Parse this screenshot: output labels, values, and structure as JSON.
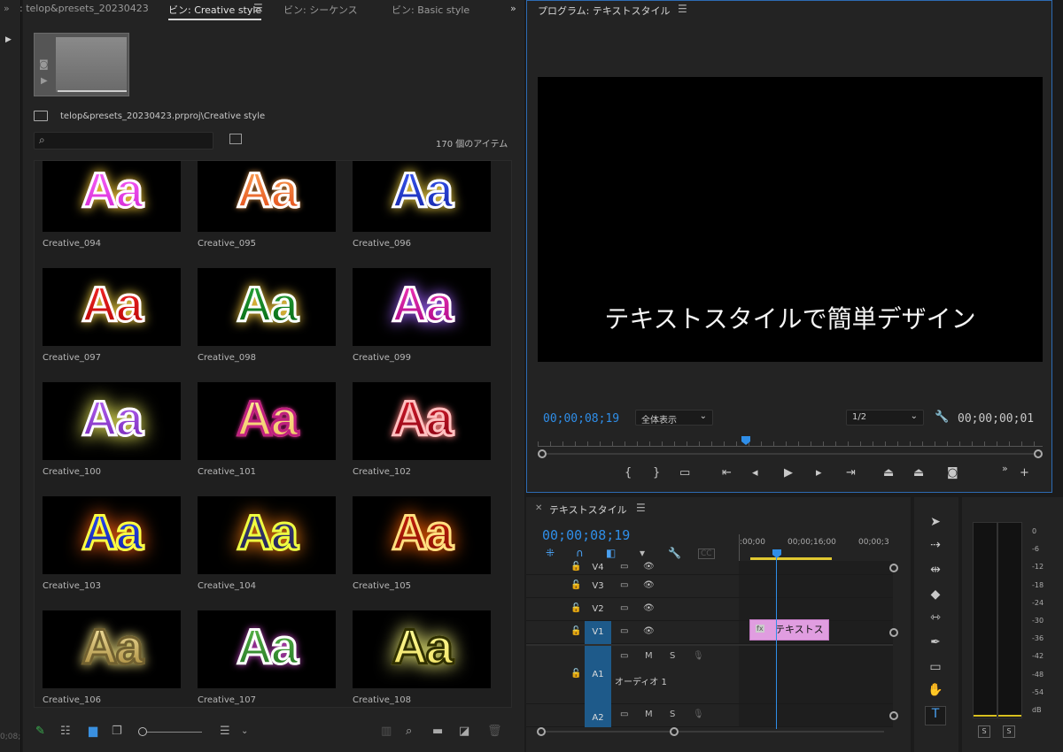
{
  "project": {
    "tabs": [
      {
        "label": ": telop&presets_20230423"
      },
      {
        "label": "ビン: Creative style"
      },
      {
        "label": "ビン: シーケンス"
      },
      {
        "label": "ビン: Basic style"
      }
    ],
    "path": "telop&presets_20230423.prproj\\Creative style",
    "search_placeholder": "",
    "item_count": "170 個のアイテム",
    "items": [
      {
        "name": "Creative_094",
        "preview": "Aa"
      },
      {
        "name": "Creative_095",
        "preview": "Aa"
      },
      {
        "name": "Creative_096",
        "preview": "Aa"
      },
      {
        "name": "Creative_097",
        "preview": "Aa"
      },
      {
        "name": "Creative_098",
        "preview": "Aa"
      },
      {
        "name": "Creative_099",
        "preview": "Aa"
      },
      {
        "name": "Creative_100",
        "preview": "Aa"
      },
      {
        "name": "Creative_101",
        "preview": "Aa"
      },
      {
        "name": "Creative_102",
        "preview": "Aa"
      },
      {
        "name": "Creative_103",
        "preview": "Aa"
      },
      {
        "name": "Creative_104",
        "preview": "Aa"
      },
      {
        "name": "Creative_105",
        "preview": "Aa"
      },
      {
        "name": "Creative_106",
        "preview": "Aa"
      },
      {
        "name": "Creative_107",
        "preview": "Aa"
      },
      {
        "name": "Creative_108",
        "preview": "Aa"
      }
    ]
  },
  "program": {
    "title": "プログラム: テキストスタイル",
    "caption": "テキストスタイルで簡単デザイン",
    "timecode": "00;00;08;19",
    "fit_option": "全体表示",
    "resolution": "1/2",
    "duration": "00;00;00;01"
  },
  "timeline": {
    "title": "テキストスタイル",
    "timecode": "00;00;08;19",
    "ruler_labels": [
      ":00;00",
      "00;00;16;00",
      "00;00;3"
    ],
    "tracks": {
      "v4": "V4",
      "v3": "V3",
      "v2": "V2",
      "v1": "V1",
      "a1": "A1",
      "a1_name": "オーディオ 1",
      "a2": "A2"
    },
    "track_buttons": {
      "mute": "M",
      "solo": "S"
    },
    "clip_label": "テキストス",
    "clip_fx": "fx"
  },
  "meters": {
    "db_scale": [
      "0",
      "-6",
      "-12",
      "-18",
      "-24",
      "-30",
      "-36",
      "-42",
      "-48",
      "-54",
      "dB"
    ],
    "solo": "S"
  },
  "colors": {
    "accent": "#2f8ee8",
    "clip": "#e09de0",
    "panel": "#232323"
  }
}
